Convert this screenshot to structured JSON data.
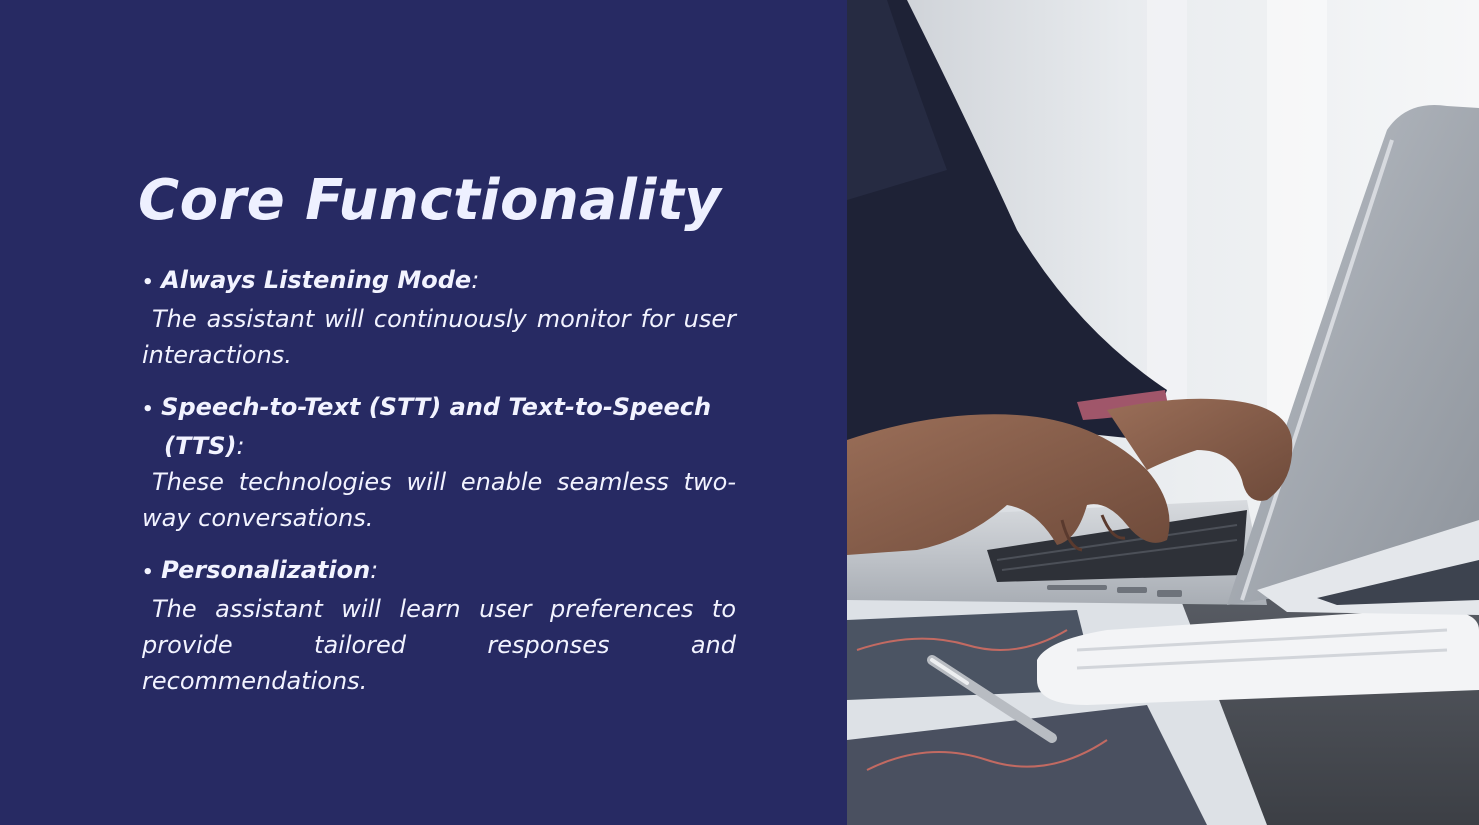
{
  "slide": {
    "title": "Core Functionality",
    "bullets": [
      {
        "term": "Always Listening Mode",
        "suffix": ":",
        "desc": "The assistant will continuously monitor for user interactions."
      },
      {
        "term": "Speech-to-Text (STT) and Text-to-Speech (TTS)",
        "suffix": ":",
        "desc": "These technologies will enable seamless two-way conversations."
      },
      {
        "term": "Personalization",
        "suffix": ":",
        "desc": "The assistant will learn user preferences to provide tailored responses and recommendations."
      }
    ],
    "bullet_symbol": "•"
  },
  "theme": {
    "panel_color": "#272A63",
    "text_color": "#F2F3FF"
  },
  "image": {
    "subject": "person-typing-on-laptop-photo"
  }
}
